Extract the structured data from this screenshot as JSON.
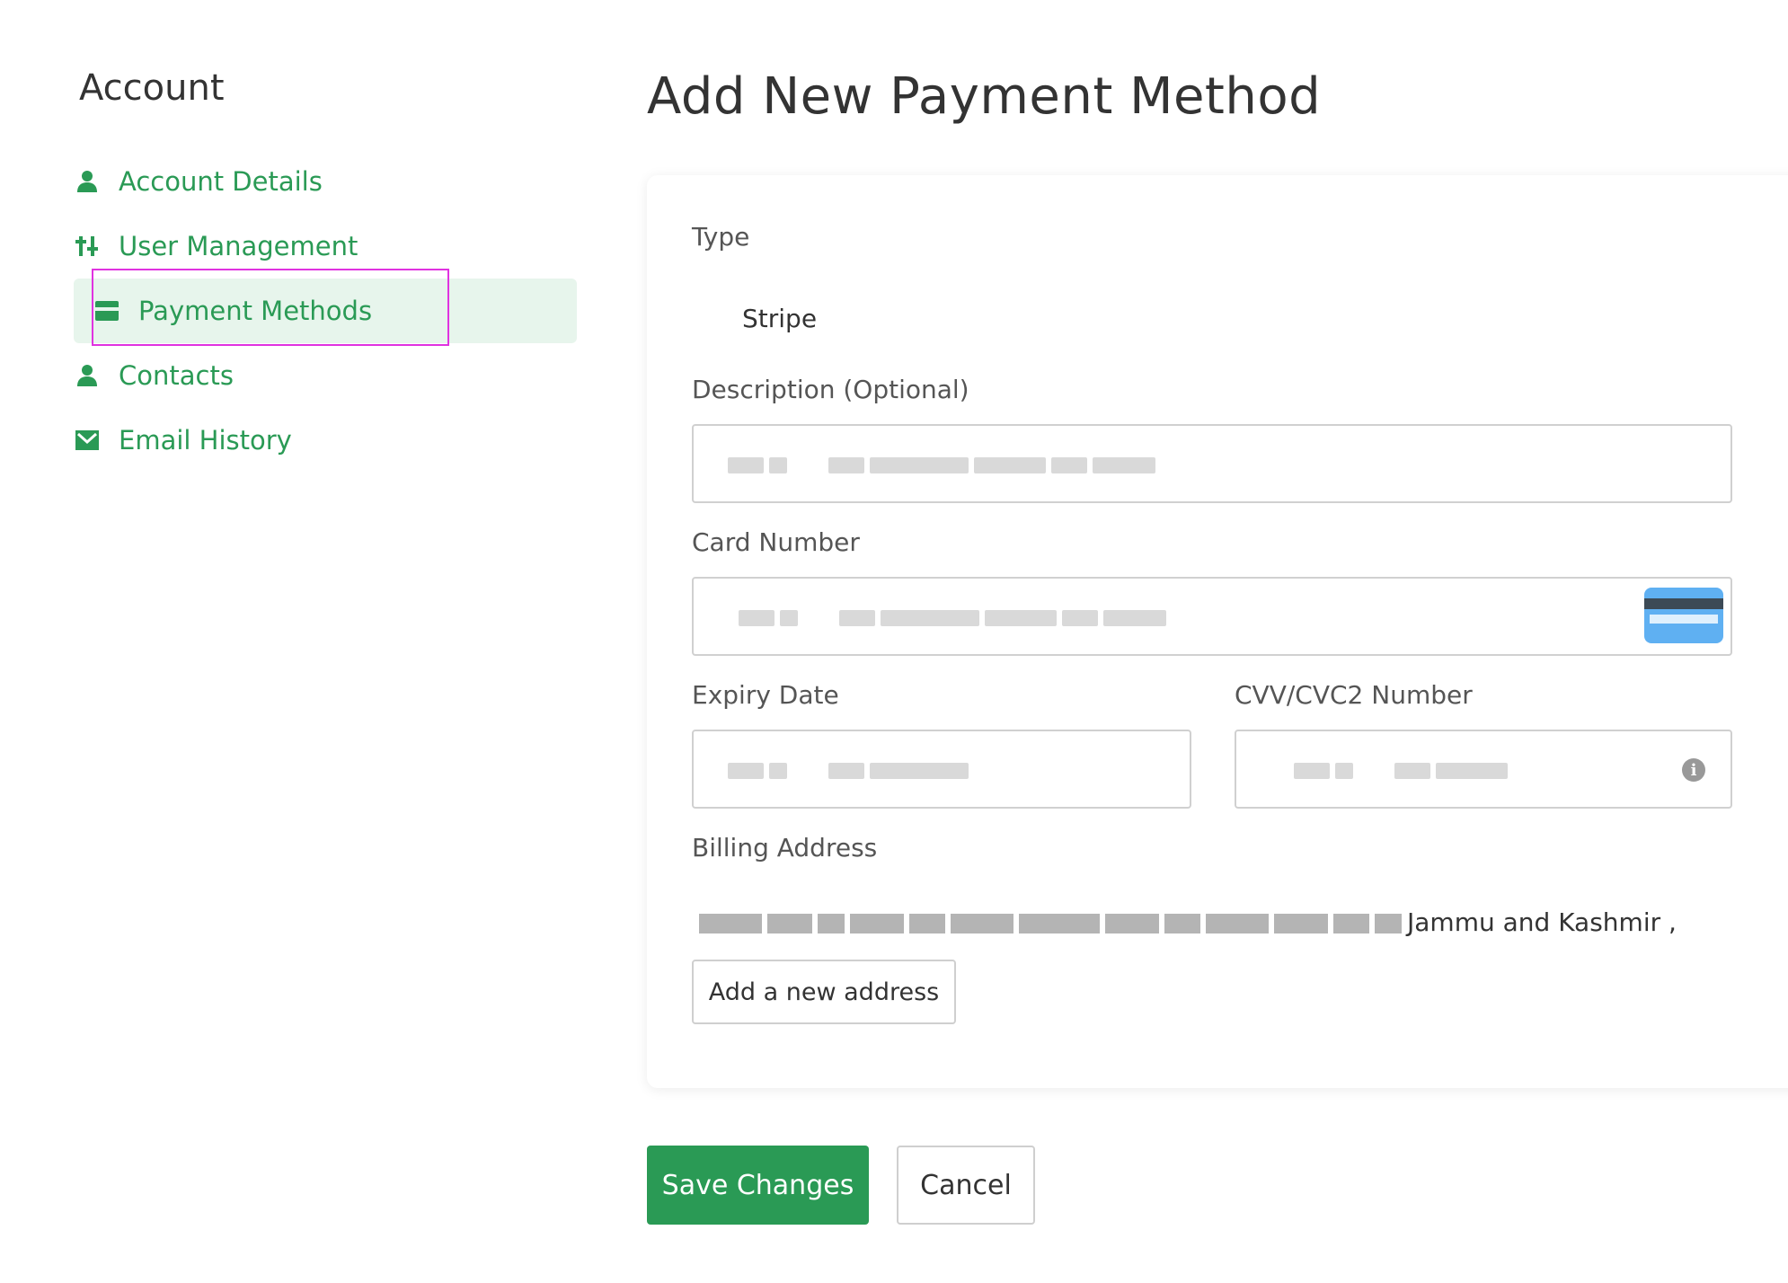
{
  "sidebar": {
    "title": "Account",
    "items": [
      {
        "label": "Account Details",
        "icon": "user-icon"
      },
      {
        "label": "User Management",
        "icon": "sliders-icon"
      },
      {
        "label": "Payment Methods",
        "icon": "credit-card-icon",
        "active": true
      },
      {
        "label": "Contacts",
        "icon": "user-icon"
      },
      {
        "label": "Email History",
        "icon": "envelope-icon"
      }
    ]
  },
  "main": {
    "title": "Add New Payment Method",
    "form": {
      "type_label": "Type",
      "type_value": "Stripe",
      "description_label": "Description (Optional)",
      "card_number_label": "Card Number",
      "expiry_label": "Expiry Date",
      "cvv_label": "CVV/CVC2 Number",
      "billing_label": "Billing Address",
      "billing_address_visible": "Jammu and Kashmir ,",
      "add_address_label": "Add a new address"
    },
    "actions": {
      "save_label": "Save Changes",
      "cancel_label": "Cancel"
    }
  },
  "colors": {
    "accent": "#2a9a55",
    "active_bg": "#e7f5ec",
    "highlight_outline": "#e033e0"
  }
}
